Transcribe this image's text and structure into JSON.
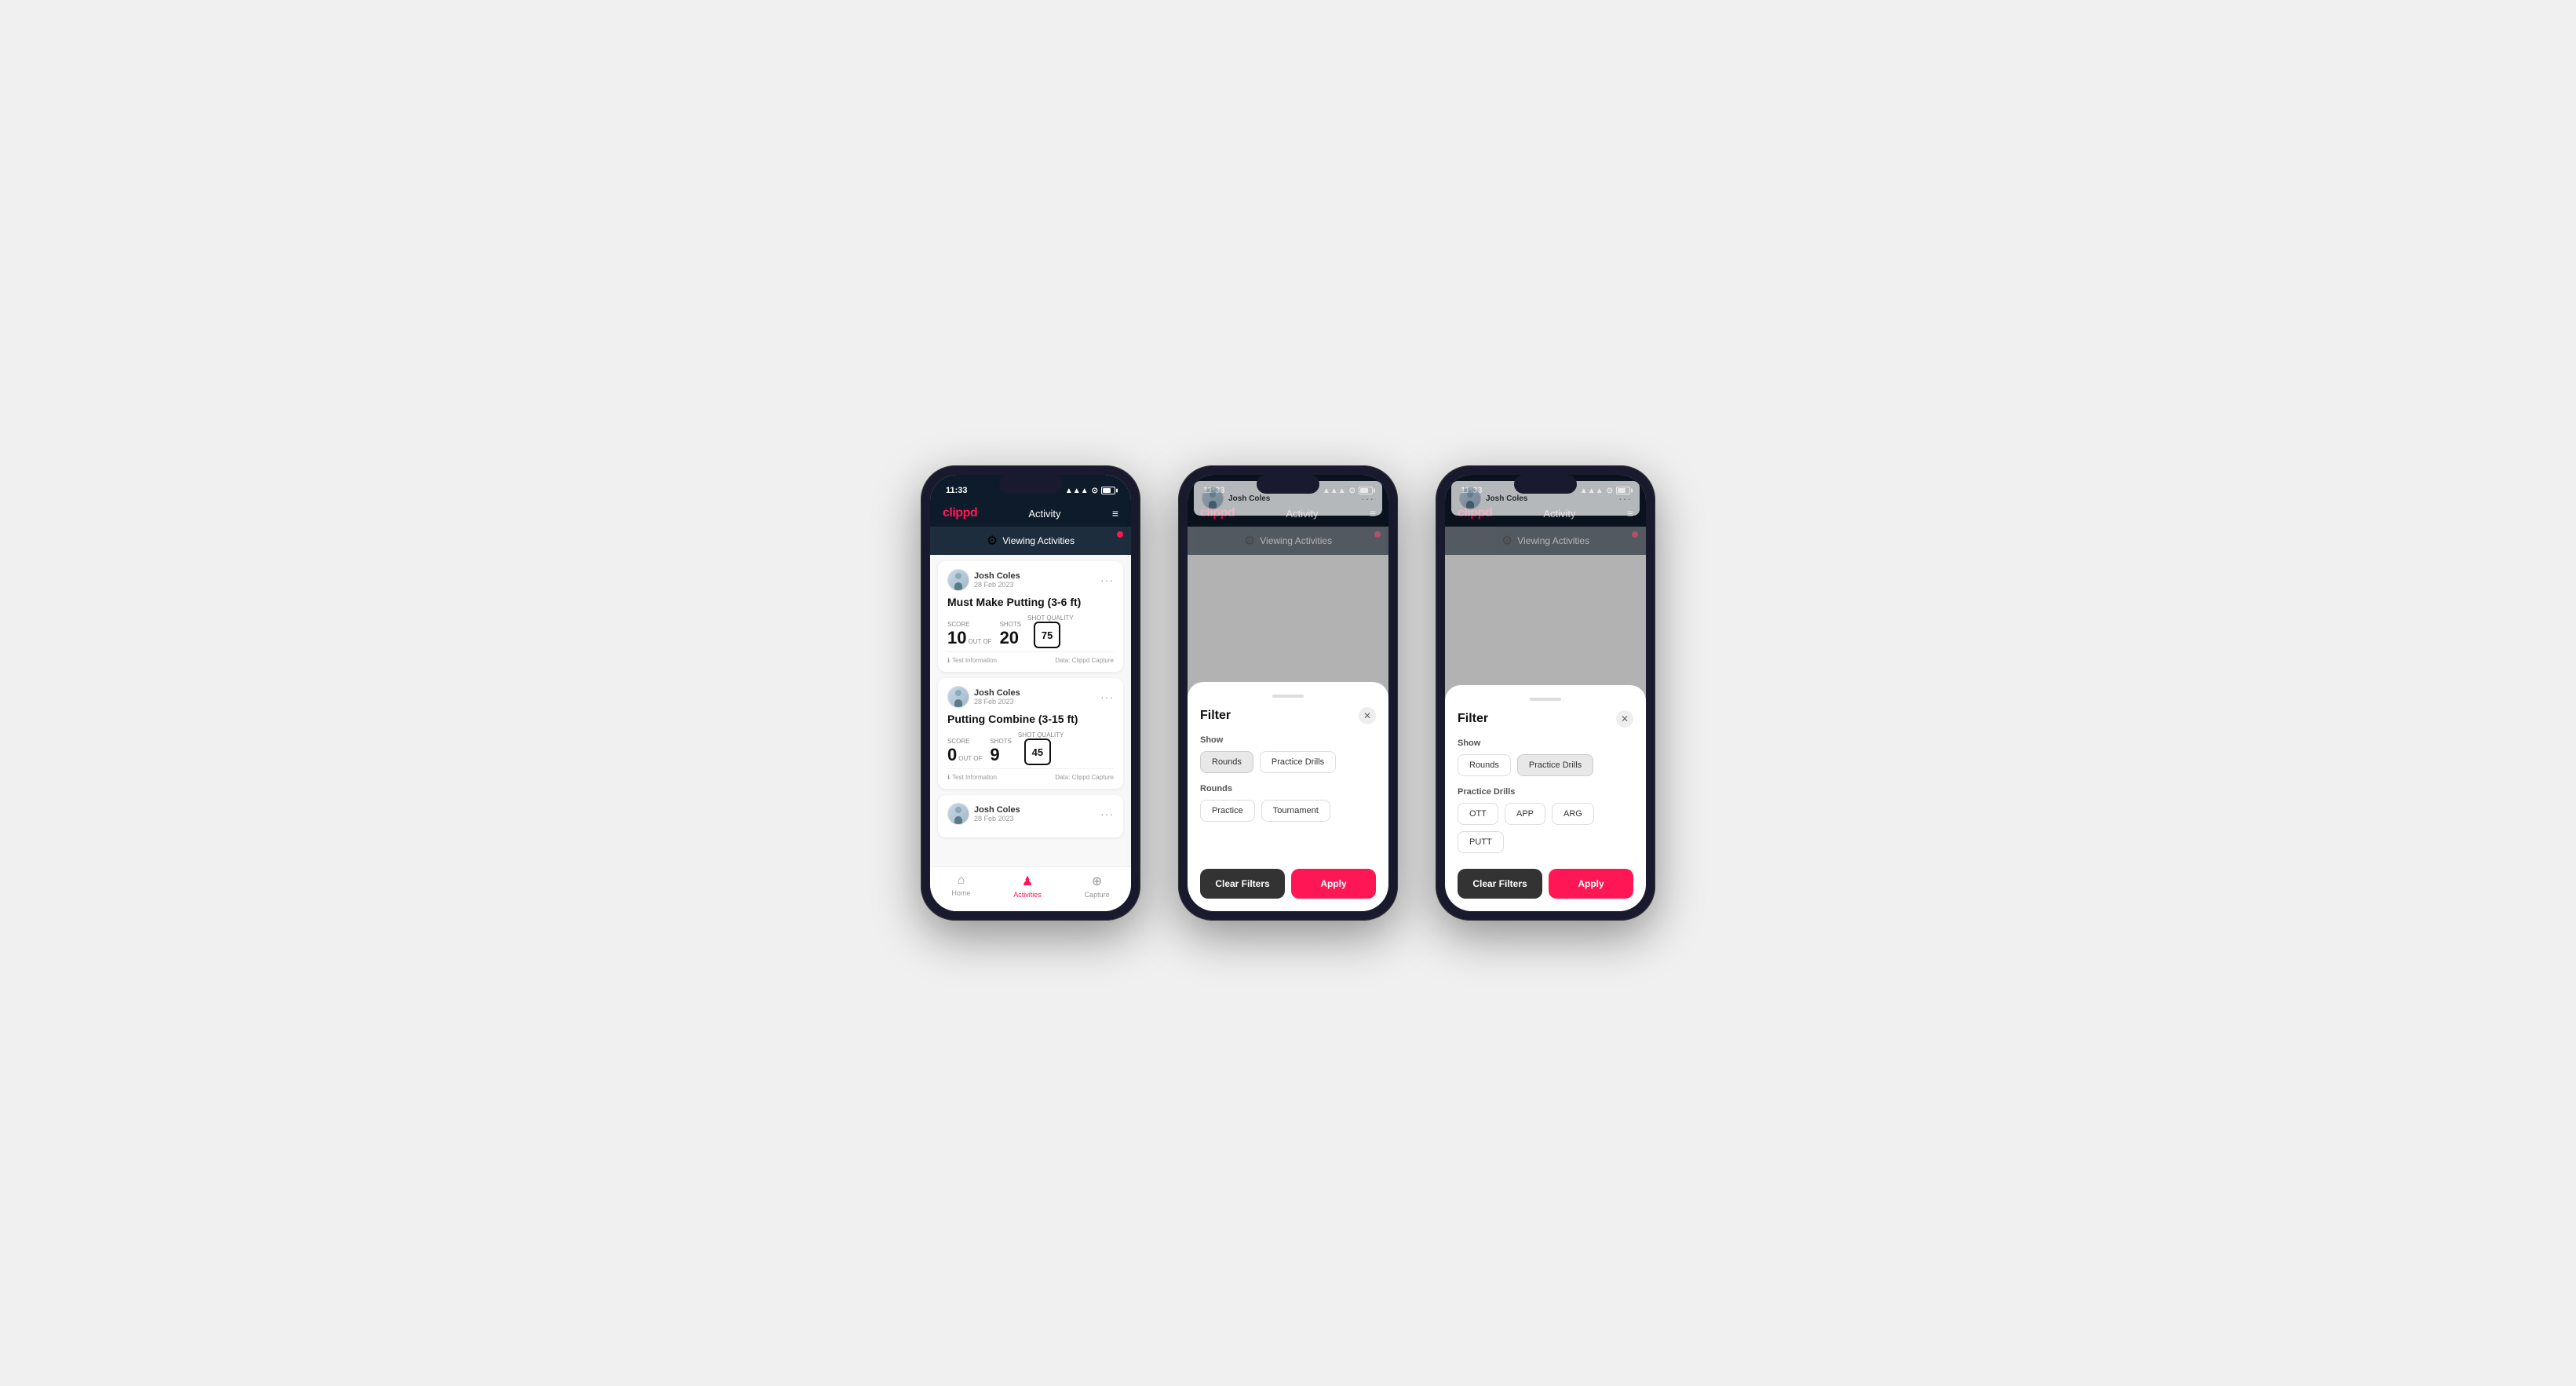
{
  "phones": [
    {
      "id": "phone1",
      "type": "activity-list",
      "statusBar": {
        "time": "11:33",
        "signal": "▲▲▲",
        "wifi": "wifi",
        "battery": "31"
      },
      "navBar": {
        "logo": "clippd",
        "title": "Activity",
        "menuIcon": "≡"
      },
      "viewingBar": {
        "icon": "⚙",
        "text": "Viewing Activities",
        "hasDot": true
      },
      "activities": [
        {
          "user": "Josh Coles",
          "date": "28 Feb 2023",
          "title": "Must Make Putting (3-6 ft)",
          "score": "10",
          "outOf": "20",
          "shotQuality": "75",
          "scorelabel": "Score",
          "shotslabel": "Shots",
          "shotQualityLabel": "Shot Quality",
          "testInfo": "Test Information",
          "dataSource": "Data: Clippd Capture"
        },
        {
          "user": "Josh Coles",
          "date": "28 Feb 2023",
          "title": "Putting Combine (3-15 ft)",
          "score": "0",
          "outOf": "9",
          "shotQuality": "45",
          "scorelabel": "Score",
          "shotslabel": "Shots",
          "shotQualityLabel": "Shot Quality",
          "testInfo": "Test Information",
          "dataSource": "Data: Clippd Capture"
        },
        {
          "user": "Josh Coles",
          "date": "28 Feb 2023",
          "title": "",
          "score": "",
          "outOf": "",
          "shotQuality": "",
          "scorelabel": "",
          "shotslabel": "",
          "shotQualityLabel": "",
          "testInfo": "",
          "dataSource": ""
        }
      ],
      "bottomNav": [
        {
          "label": "Home",
          "icon": "⌂",
          "active": false
        },
        {
          "label": "Activities",
          "icon": "♟",
          "active": true
        },
        {
          "label": "Capture",
          "icon": "⊕",
          "active": false
        }
      ]
    },
    {
      "id": "phone2",
      "type": "filter-modal-rounds",
      "statusBar": {
        "time": "11:33",
        "signal": "▲▲▲",
        "wifi": "wifi",
        "battery": "31"
      },
      "navBar": {
        "logo": "clippd",
        "title": "Activity",
        "menuIcon": "≡"
      },
      "viewingBar": {
        "icon": "⚙",
        "text": "Viewing Activities",
        "hasDot": true
      },
      "filter": {
        "title": "Filter",
        "showLabel": "Show",
        "showButtons": [
          {
            "label": "Rounds",
            "active": true
          },
          {
            "label": "Practice Drills",
            "active": false
          }
        ],
        "roundsLabel": "Rounds",
        "roundsButtons": [
          {
            "label": "Practice",
            "active": false
          },
          {
            "label": "Tournament",
            "active": false
          }
        ],
        "clearLabel": "Clear Filters",
        "applyLabel": "Apply"
      }
    },
    {
      "id": "phone3",
      "type": "filter-modal-drills",
      "statusBar": {
        "time": "11:33",
        "signal": "▲▲▲",
        "wifi": "wifi",
        "battery": "31"
      },
      "navBar": {
        "logo": "clippd",
        "title": "Activity",
        "menuIcon": "≡"
      },
      "viewingBar": {
        "icon": "⚙",
        "text": "Viewing Activities",
        "hasDot": true
      },
      "filter": {
        "title": "Filter",
        "showLabel": "Show",
        "showButtons": [
          {
            "label": "Rounds",
            "active": false
          },
          {
            "label": "Practice Drills",
            "active": true
          }
        ],
        "drillsLabel": "Practice Drills",
        "drillsButtons": [
          {
            "label": "OTT",
            "active": false
          },
          {
            "label": "APP",
            "active": false
          },
          {
            "label": "ARG",
            "active": false
          },
          {
            "label": "PUTT",
            "active": false
          }
        ],
        "clearLabel": "Clear Filters",
        "applyLabel": "Apply"
      }
    }
  ]
}
